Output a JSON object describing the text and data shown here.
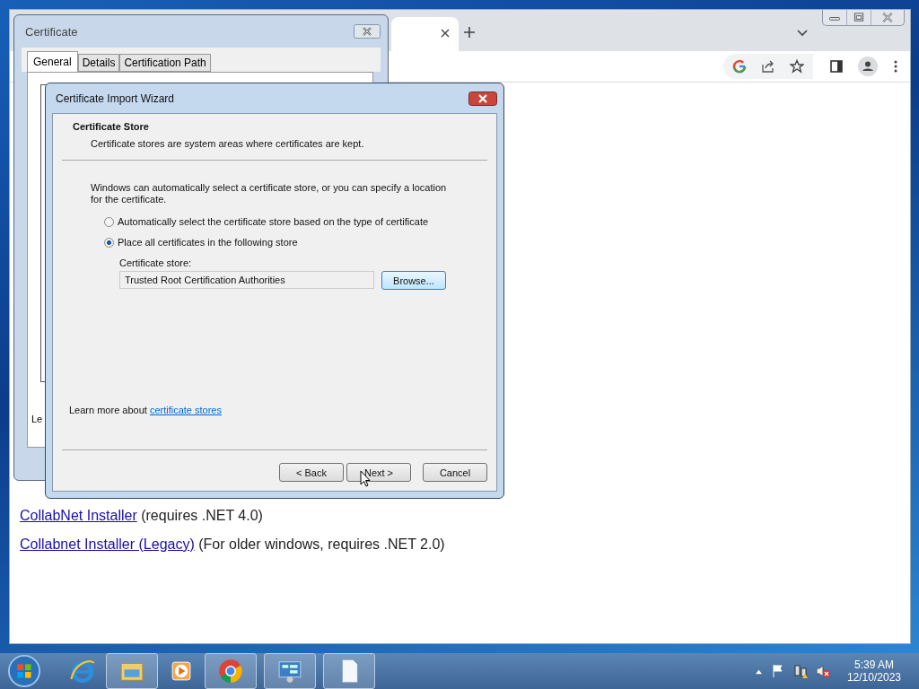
{
  "browser": {
    "links": [
      {
        "link": "CollabNet Installer",
        "note": "(requires .NET 4.0)"
      },
      {
        "link": "Collabnet Installer (Legacy)",
        "note": "(For older windows, requires .NET 2.0)"
      }
    ]
  },
  "certificate_dialog": {
    "title": "Certificate",
    "tabs": [
      {
        "label": "General",
        "selected": true
      },
      {
        "label": "Details",
        "selected": false
      },
      {
        "label": "Certification Path",
        "selected": false
      }
    ],
    "cut_text": "Le"
  },
  "wizard": {
    "title": "Certificate Import Wizard",
    "heading": "Certificate Store",
    "subheading": "Certificate stores are system areas where certificates are kept.",
    "intro": "Windows can automatically select a certificate store, or you can specify a location for the certificate.",
    "options": [
      {
        "label": "Automatically select the certificate store based on the type of certificate",
        "selected": false
      },
      {
        "label": "Place all certificates in the following store",
        "selected": true
      }
    ],
    "store_label": "Certificate store:",
    "store_value": "Trusted Root Certification Authorities",
    "browse_button": "Browse...",
    "learn_more": {
      "text": "Learn more about",
      "link": "certificate stores"
    },
    "buttons": [
      "< Back",
      "Next >",
      "Cancel"
    ]
  },
  "taskbar": {
    "time": "5:39 AM",
    "date": "12/10/2023"
  }
}
